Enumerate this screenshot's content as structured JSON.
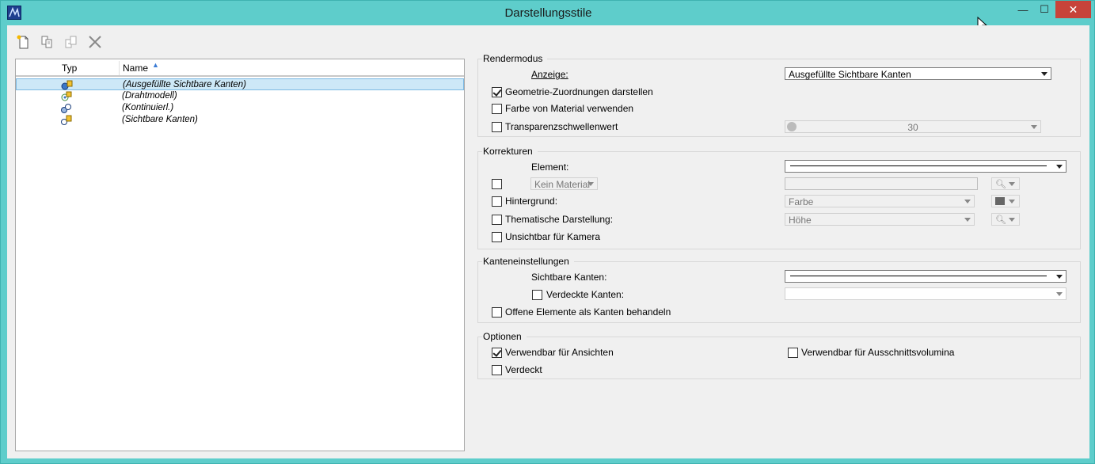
{
  "window": {
    "title": "Darstellungsstile",
    "minimize_glyph": "—",
    "maximize_glyph": "☐",
    "close_glyph": "✕"
  },
  "toolbar": {
    "icons": [
      "new-style-icon",
      "copy-icon",
      "import-icon",
      "delete-icon"
    ]
  },
  "list": {
    "col_typ": "Typ",
    "col_name": "Name",
    "rows": [
      {
        "name": "(Ausgefüllte Sichtbare Kanten)",
        "icon": "filled-visible-edges-icon",
        "selected": true
      },
      {
        "name": "(Drahtmodell)",
        "icon": "wireframe-icon",
        "selected": false
      },
      {
        "name": "(Kontinuierl.)",
        "icon": "smooth-icon",
        "selected": false
      },
      {
        "name": "(Sichtbare Kanten)",
        "icon": "visible-edges-icon",
        "selected": false
      }
    ]
  },
  "rendermodus": {
    "title": "Rendermodus",
    "anzeige_label": "Anzeige:",
    "anzeige_value": "Ausgefüllte Sichtbare Kanten",
    "geometrie_label": "Geometrie-Zuordnungen darstellen",
    "geometrie_checked": true,
    "farbe_label": "Farbe von Material verwenden",
    "farbe_checked": false,
    "transparenz_label": "Transparenzschwellenwert",
    "transparenz_checked": false,
    "transparenz_value": "30"
  },
  "korrekturen": {
    "title": "Korrekturen",
    "element_label": "Element:",
    "material_value": "Kein Material",
    "hintergrund_label": "Hintergrund:",
    "hintergrund_value": "Farbe",
    "thematisch_label": "Thematische Darstellung:",
    "thematisch_value": "Höhe",
    "unsichtbar_label": "Unsichtbar für Kamera"
  },
  "kanten": {
    "title": "Kanteneinstellungen",
    "sichtbare_label": "Sichtbare Kanten:",
    "verdeckte_label": "Verdeckte Kanten:",
    "offene_label": "Offene Elemente als Kanten behandeln"
  },
  "optionen": {
    "title": "Optionen",
    "ansichten_label": "Verwendbar für Ansichten",
    "ansichten_checked": true,
    "verdeckt_label": "Verdeckt",
    "ausschnitt_label": "Verwendbar für Ausschnittsvolumina"
  }
}
